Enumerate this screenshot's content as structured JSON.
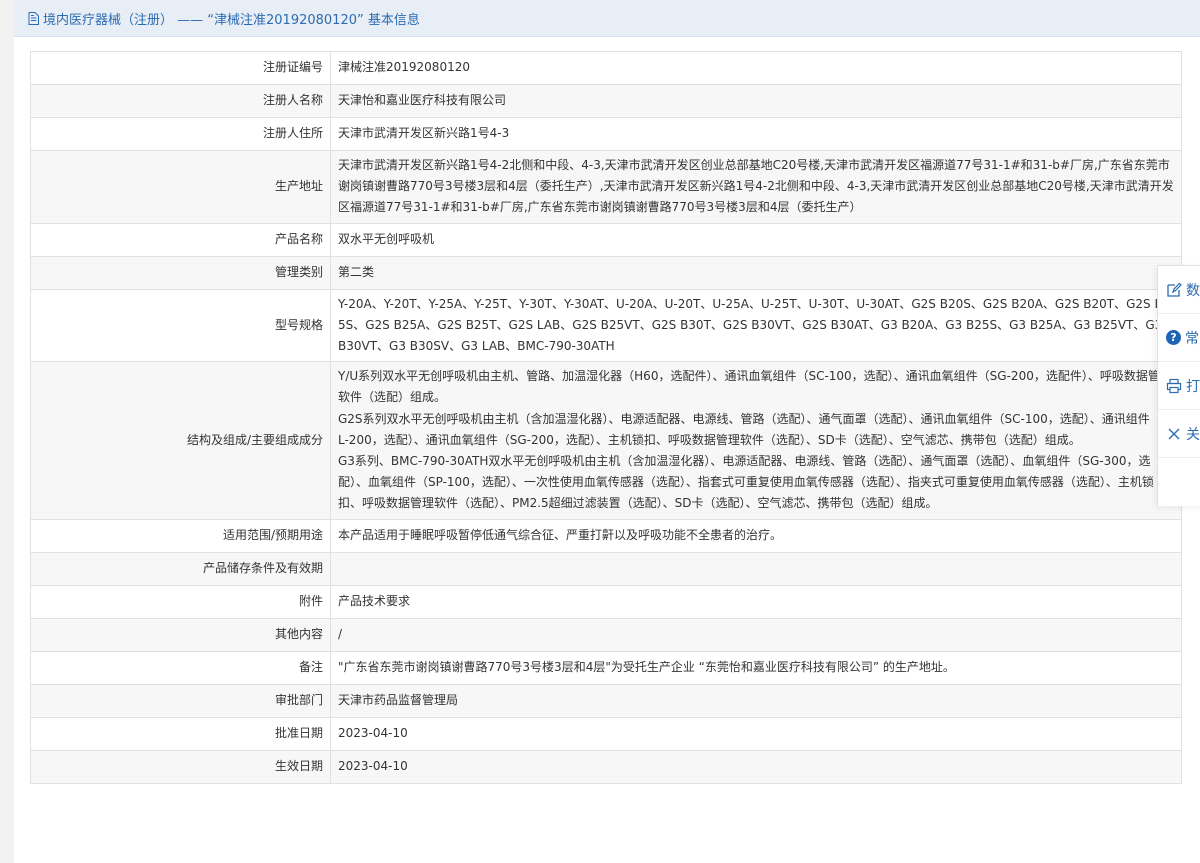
{
  "header": {
    "title": "境内医疗器械（注册） —— “津械注准20192080120” 基本信息"
  },
  "rows": [
    {
      "label": "注册证编号",
      "value": "津械注准20192080120"
    },
    {
      "label": "注册人名称",
      "value": "天津怡和嘉业医疗科技有限公司"
    },
    {
      "label": "注册人住所",
      "value": "天津市武清开发区新兴路1号4-3"
    },
    {
      "label": "生产地址",
      "value": "天津市武清开发区新兴路1号4-2北侧和中段、4-3,天津市武清开发区创业总部基地C20号楼,天津市武清开发区福源道77号31-1#和31-b#厂房,广东省东莞市谢岗镇谢曹路770号3号楼3层和4层（委托生产）,天津市武清开发区新兴路1号4-2北侧和中段、4-3,天津市武清开发区创业总部基地C20号楼,天津市武清开发区福源道77号31-1#和31-b#厂房,广东省东莞市谢岗镇谢曹路770号3号楼3层和4层（委托生产）"
    },
    {
      "label": "产品名称",
      "value": "双水平无创呼吸机"
    },
    {
      "label": "管理类别",
      "value": "第二类"
    },
    {
      "label": "型号规格",
      "value": "Y-20A、Y-20T、Y-25A、Y-25T、Y-30T、Y-30AT、U-20A、U-20T、U-25A、U-25T、U-30T、U-30AT、G2S B20S、G2S B20A、G2S B20T、G2S B25S、G2S B25A、G2S B25T、G2S LAB、G2S B25VT、G2S B30T、G2S B30VT、G2S B30AT、G3 B20A、G3 B25S、G3 B25A、G3 B25VT、G3 B30VT、G3 B30SV、G3 LAB、BMC-790-30ATH"
    },
    {
      "label": "结构及组成/主要组成成分",
      "paragraphs": [
        "Y/U系列双水平无创呼吸机由主机、管路、加温湿化器（H60，选配件）、通讯血氧组件（SC-100，选配）、通讯血氧组件（SG-200，选配件）、呼吸数据管理软件（选配）组成。",
        "G2S系列双水平无创呼吸机由主机（含加温湿化器）、电源适配器、电源线、管路（选配）、通气面罩（选配）、通讯血氧组件（SC-100，选配）、通讯组件（WL-200，选配）、通讯血氧组件（SG-200，选配）、主机锁扣、呼吸数据管理软件（选配）、SD卡（选配）、空气滤芯、携带包（选配）组成。",
        "G3系列、BMC-790-30ATH双水平无创呼吸机由主机（含加温湿化器）、电源适配器、电源线、管路（选配）、通气面罩（选配）、血氧组件（SG-300，选配）、血氧组件（SP-100，选配）、一次性使用血氧传感器（选配）、指套式可重复使用血氧传感器（选配）、指夹式可重复使用血氧传感器（选配）、主机锁扣、呼吸数据管理软件（选配）、PM2.5超细过滤装置（选配）、SD卡（选配）、空气滤芯、携带包（选配）组成。"
      ]
    },
    {
      "label": "适用范围/预期用途",
      "value": "本产品适用于睡眠呼吸暂停低通气综合征、严重打鼾以及呼吸功能不全患者的治疗。"
    },
    {
      "label": "产品储存条件及有效期",
      "value": ""
    },
    {
      "label": "附件",
      "value": "产品技术要求"
    },
    {
      "label": "其他内容",
      "value": "/"
    },
    {
      "label": "备注",
      "value": "\"广东省东莞市谢岗镇谢曹路770号3号楼3层和4层\"为受托生产企业 “东莞怡和嘉业医疗科技有限公司” 的生产地址。"
    },
    {
      "label": "审批部门",
      "value": "天津市药品监督管理局"
    },
    {
      "label": "批准日期",
      "value": "2023-04-10"
    },
    {
      "label": "生效日期",
      "value": "2023-04-10"
    }
  ],
  "toolbar": {
    "items": [
      {
        "icon": "edit-icon",
        "label": "数"
      },
      {
        "icon": "help-icon",
        "label": "常"
      },
      {
        "icon": "print-icon",
        "label": "打"
      },
      {
        "icon": "close-icon",
        "label": "关"
      }
    ]
  },
  "colors": {
    "accent": "#2c6bb0",
    "header_bg": "#e8eef6",
    "row_alt": "#f7f7f7",
    "border": "#e1e1e1"
  }
}
